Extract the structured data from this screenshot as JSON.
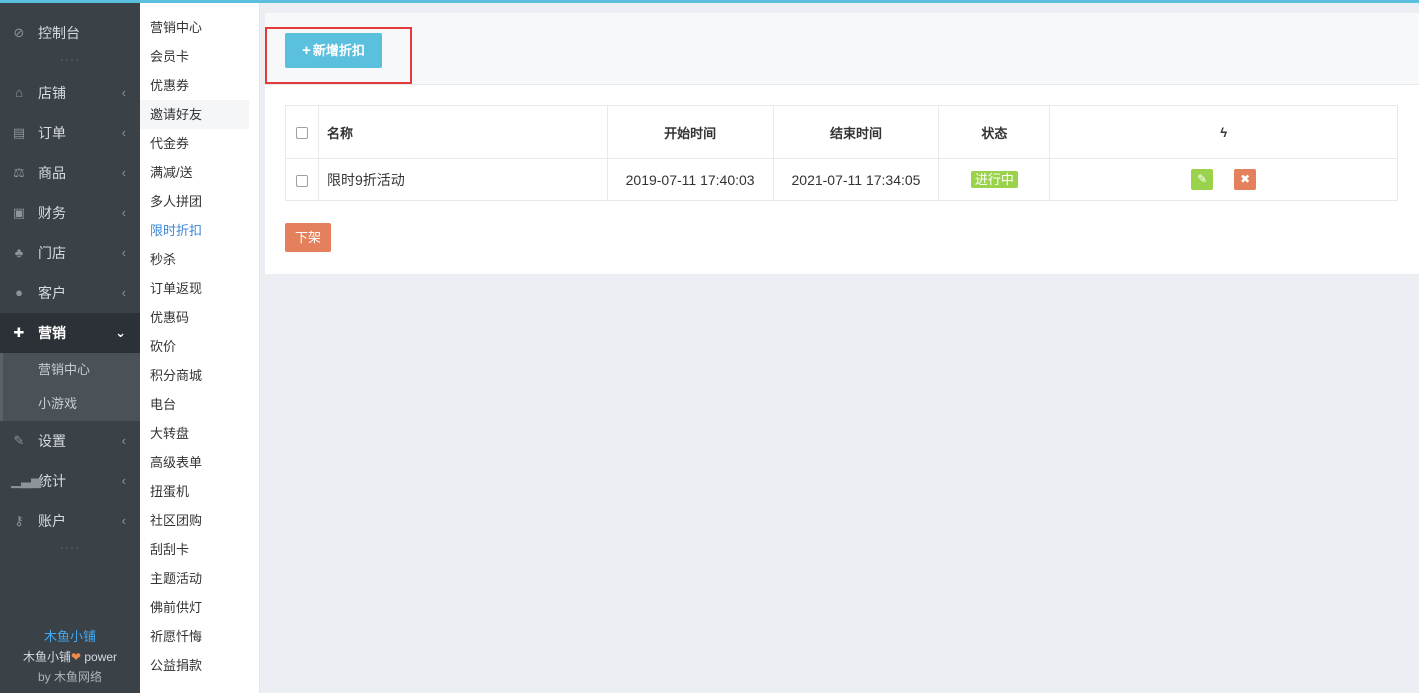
{
  "sidebar": {
    "items": [
      {
        "label": "控制台",
        "icon": "dashboard-icon"
      },
      {
        "label": "店铺",
        "icon": "shop-icon"
      },
      {
        "label": "订单",
        "icon": "order-icon"
      },
      {
        "label": "商品",
        "icon": "scale-icon"
      },
      {
        "label": "财务",
        "icon": "money-icon"
      },
      {
        "label": "门店",
        "icon": "sitemap-icon"
      },
      {
        "label": "客户",
        "icon": "users-icon"
      },
      {
        "label": "营销",
        "icon": "gift-icon"
      },
      {
        "label": "设置",
        "icon": "wrench-icon"
      },
      {
        "label": "统计",
        "icon": "signal-icon"
      },
      {
        "label": "账户",
        "icon": "key-icon"
      }
    ],
    "sub_items": [
      "营销中心",
      "小游戏"
    ],
    "dots": "····",
    "footer": {
      "brand": "木鱼小铺",
      "power_prefix": "木鱼小铺",
      "heart": "❤",
      "power_suffix": " power",
      "by": "by 木鱼网络"
    }
  },
  "subnav": {
    "items": [
      "营销中心",
      "会员卡",
      "优惠券",
      "邀请好友",
      "代金券",
      "满减/送",
      "多人拼团",
      "限时折扣",
      "秒杀",
      "订单返现",
      "优惠码",
      "砍价",
      "积分商城",
      "电台",
      "大转盘",
      "高级表单",
      "扭蛋机",
      "社区团购",
      "刮刮卡",
      "主题活动",
      "佛前供灯",
      "祈愿忏悔",
      "公益捐款"
    ],
    "current_index": 7,
    "hover_index": 3
  },
  "toolbar": {
    "add_plus": "+",
    "add_label": "新增折扣"
  },
  "table": {
    "headers": [
      "名称",
      "开始时间",
      "结束时间",
      "状态",
      "ϟ"
    ],
    "rows": [
      {
        "name": "限时9折活动",
        "start": "2019-07-11 17:40:03",
        "end": "2021-07-11 17:34:05",
        "status": "进行中"
      }
    ]
  },
  "actions": {
    "edit_icon": "pencil-icon",
    "delete_icon": "close-icon",
    "edit_glyph": "✎",
    "delete_glyph": "✖"
  },
  "off_button": "下架",
  "colors": {
    "accent": "#5bc0de",
    "sidebar": "#3a4147",
    "success": "#9ad34b",
    "danger": "#e4805c",
    "highlight": "#e23b3b"
  }
}
